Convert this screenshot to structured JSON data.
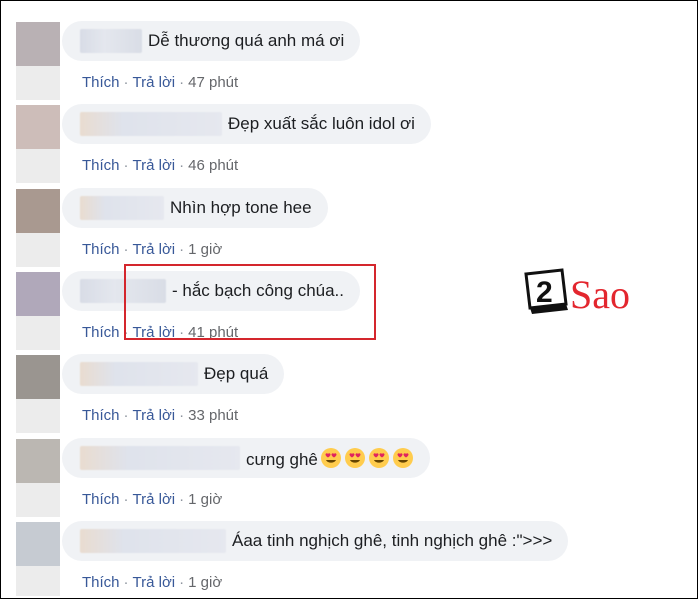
{
  "comments": [
    {
      "text": "Dễ thương quá anh má ơi",
      "like": "Thích",
      "reply": "Trả lời",
      "time": "47 phút"
    },
    {
      "text": "Đẹp xuất sắc luôn idol ơi",
      "like": "Thích",
      "reply": "Trả lời",
      "time": "46 phút"
    },
    {
      "text": "Nhìn hợp tone hee",
      "like": "Thích",
      "reply": "Trả lời",
      "time": "1 giờ"
    },
    {
      "text": "- hắc bạch công chúa..",
      "like": "Thích",
      "reply": "Trả lời",
      "time": "41 phút"
    },
    {
      "text": "Đẹp quá",
      "like": "Thích",
      "reply": "Trả lời",
      "time": "33 phút"
    },
    {
      "text": "cưng ghê",
      "emoji": "heart-eyes-emoji x4",
      "like": "Thích",
      "reply": "Trả lời",
      "time": "1 giờ"
    },
    {
      "text": "Áaa tinh nghịch ghê, tinh nghịch ghê :\">>>",
      "like": "Thích",
      "reply": "Trả lời",
      "time": "1 giờ"
    }
  ],
  "separator": "·",
  "watermark": {
    "number": "2",
    "word": "Sao",
    "accent": "#e3262e"
  },
  "highlight_color": "#d4262d"
}
